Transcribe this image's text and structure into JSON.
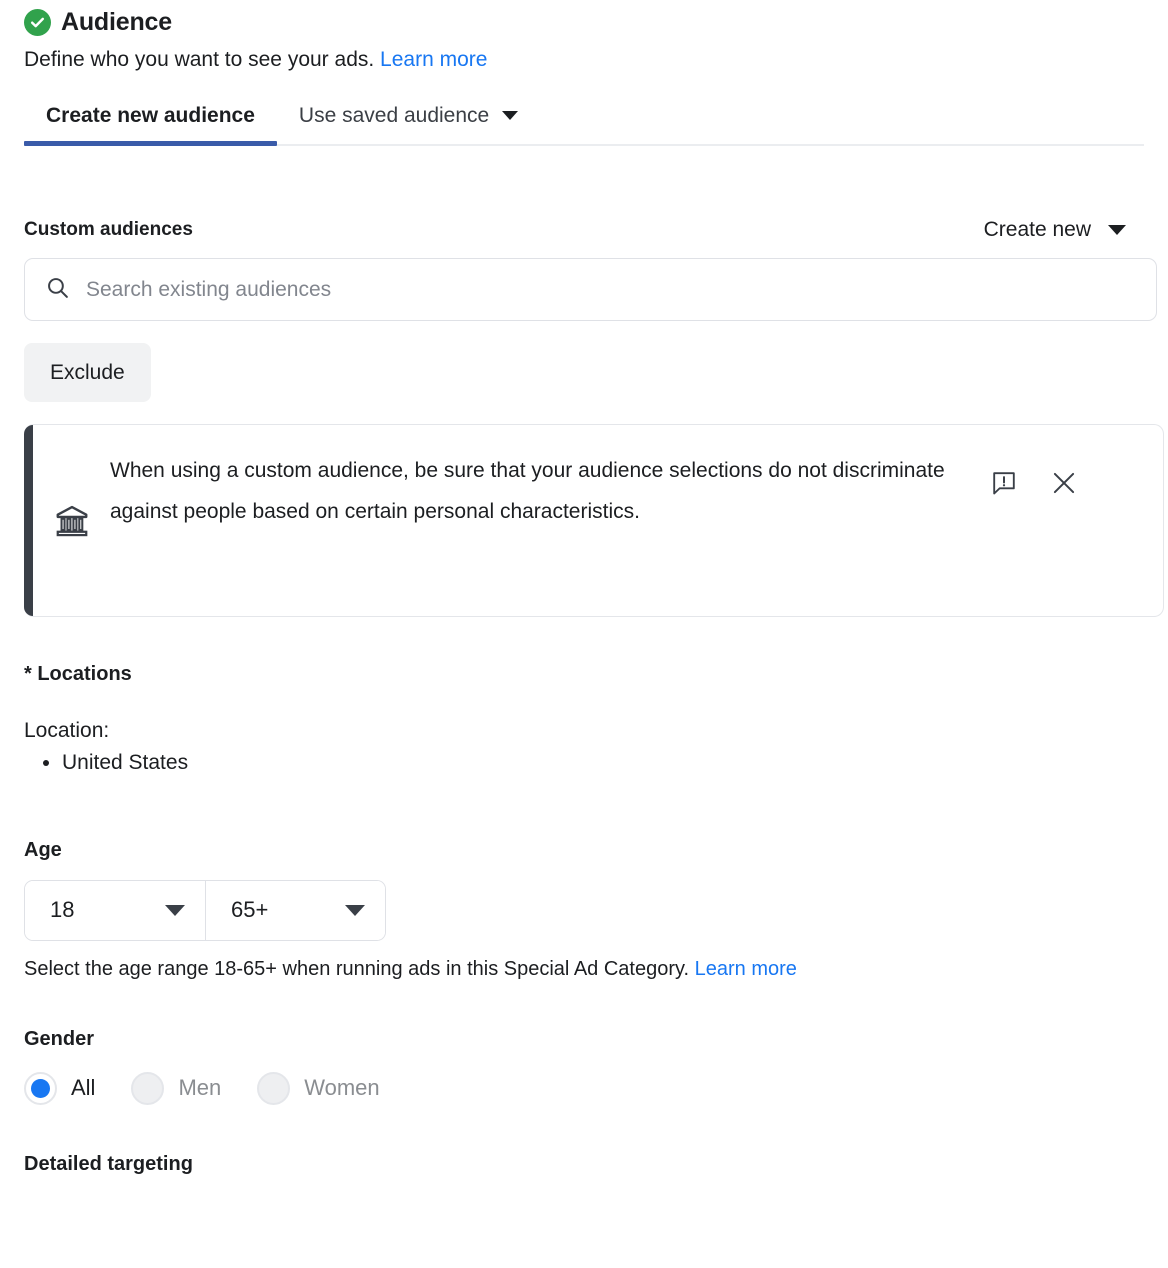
{
  "header": {
    "status_icon": "check-circle-icon",
    "title": "Audience",
    "description": "Define who you want to see your ads.",
    "learn_more": "Learn more",
    "accent_green": "#31A24C"
  },
  "tabs": [
    {
      "label": "Create new audience",
      "active": true
    },
    {
      "label": "Use saved audience",
      "active": false,
      "has_caret": true
    }
  ],
  "tab_accent": "#3A5BA9",
  "custom_audiences": {
    "label": "Custom audiences",
    "create_new": "Create new",
    "search_placeholder": "Search existing audiences",
    "search_value": "",
    "search_icon": "search-icon",
    "exclude_button": "Exclude"
  },
  "notice": {
    "icon": "bank-institution-icon",
    "text": "When using a custom audience, be sure that your audience selections do not discriminate against people based on certain personal characteristics.",
    "feedback_icon": "feedback-alert-bubble-icon",
    "close_icon": "close-icon",
    "accent_color": "#3A3F47"
  },
  "locations": {
    "title": "* Locations",
    "label": "Location:",
    "items": [
      "United States"
    ]
  },
  "age": {
    "title": "Age",
    "min_value": "18",
    "max_value": "65+",
    "help_text": "Select the age range 18-65+ when running ads in this Special Ad Category.",
    "help_link": "Learn more"
  },
  "gender": {
    "title": "Gender",
    "options": [
      {
        "label": "All",
        "selected": true,
        "disabled": false
      },
      {
        "label": "Men",
        "selected": false,
        "disabled": true
      },
      {
        "label": "Women",
        "selected": false,
        "disabled": true
      }
    ],
    "selected_color": "#1877F2"
  },
  "detailed_targeting": {
    "title": "Detailed targeting"
  }
}
